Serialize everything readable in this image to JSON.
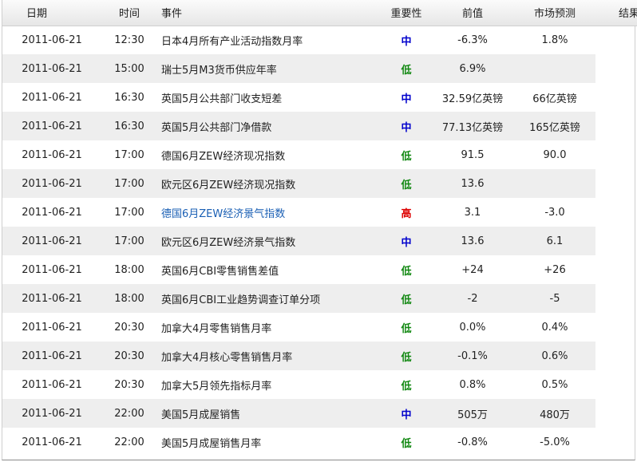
{
  "headers": {
    "date": "日期",
    "time": "时间",
    "event": "事件",
    "importance": "重要性",
    "previous": "前值",
    "forecast": "市场预测",
    "result": "结果"
  },
  "colors": {
    "importance_mid": "#0000cc",
    "importance_low": "#118811",
    "importance_high": "#dd0000",
    "link": "#1a5fb4",
    "row_shade": "#eeeeee"
  },
  "rows": [
    {
      "date": "2011-06-21",
      "time": "12:30",
      "event": "日本4月所有产业活动指数月率",
      "importance": "中",
      "level": "mid",
      "previous": "-6.3%",
      "forecast": "1.8%",
      "result": "",
      "link": false
    },
    {
      "date": "2011-06-21",
      "time": "15:00",
      "event": "瑞士5月M3货币供应年率",
      "importance": "低",
      "level": "low",
      "previous": "6.9%",
      "forecast": "",
      "result": "",
      "link": false
    },
    {
      "date": "2011-06-21",
      "time": "16:30",
      "event": "英国5月公共部门收支短差",
      "importance": "中",
      "level": "mid",
      "previous": "32.59亿英镑",
      "forecast": "66亿英镑",
      "result": "",
      "link": false
    },
    {
      "date": "2011-06-21",
      "time": "16:30",
      "event": "英国5月公共部门净借款",
      "importance": "中",
      "level": "mid",
      "previous": "77.13亿英镑",
      "forecast": "165亿英镑",
      "result": "",
      "link": false
    },
    {
      "date": "2011-06-21",
      "time": "17:00",
      "event": "德国6月ZEW经济现况指数",
      "importance": "低",
      "level": "low",
      "previous": "91.5",
      "forecast": "90.0",
      "result": "",
      "link": false
    },
    {
      "date": "2011-06-21",
      "time": "17:00",
      "event": "欧元区6月ZEW经济现况指数",
      "importance": "低",
      "level": "low",
      "previous": "13.6",
      "forecast": "",
      "result": "",
      "link": false
    },
    {
      "date": "2011-06-21",
      "time": "17:00",
      "event": "德国6月ZEW经济景气指数",
      "importance": "高",
      "level": "high",
      "previous": "3.1",
      "forecast": "-3.0",
      "result": "",
      "link": true
    },
    {
      "date": "2011-06-21",
      "time": "17:00",
      "event": "欧元区6月ZEW经济景气指数",
      "importance": "中",
      "level": "mid",
      "previous": "13.6",
      "forecast": "6.1",
      "result": "",
      "link": false
    },
    {
      "date": "2011-06-21",
      "time": "18:00",
      "event": "英国6月CBI零售销售差值",
      "importance": "低",
      "level": "low",
      "previous": "+24",
      "forecast": "+26",
      "result": "",
      "link": false
    },
    {
      "date": "2011-06-21",
      "time": "18:00",
      "event": "英国6月CBI工业趋势调查订单分项",
      "importance": "低",
      "level": "low",
      "previous": "-2",
      "forecast": "-5",
      "result": "",
      "link": false
    },
    {
      "date": "2011-06-21",
      "time": "20:30",
      "event": "加拿大4月零售销售月率",
      "importance": "低",
      "level": "low",
      "previous": "0.0%",
      "forecast": "0.4%",
      "result": "",
      "link": false
    },
    {
      "date": "2011-06-21",
      "time": "20:30",
      "event": "加拿大4月核心零售销售月率",
      "importance": "低",
      "level": "low",
      "previous": "-0.1%",
      "forecast": "0.6%",
      "result": "",
      "link": false
    },
    {
      "date": "2011-06-21",
      "time": "20:30",
      "event": "加拿大5月领先指标月率",
      "importance": "低",
      "level": "low",
      "previous": "0.8%",
      "forecast": "0.5%",
      "result": "",
      "link": false
    },
    {
      "date": "2011-06-21",
      "time": "22:00",
      "event": "美国5月成屋销售",
      "importance": "中",
      "level": "mid",
      "previous": "505万",
      "forecast": "480万",
      "result": "",
      "link": false
    },
    {
      "date": "2011-06-21",
      "time": "22:00",
      "event": "美国5月成屋销售月率",
      "importance": "低",
      "level": "low",
      "previous": "-0.8%",
      "forecast": "-5.0%",
      "result": "",
      "link": false
    }
  ]
}
